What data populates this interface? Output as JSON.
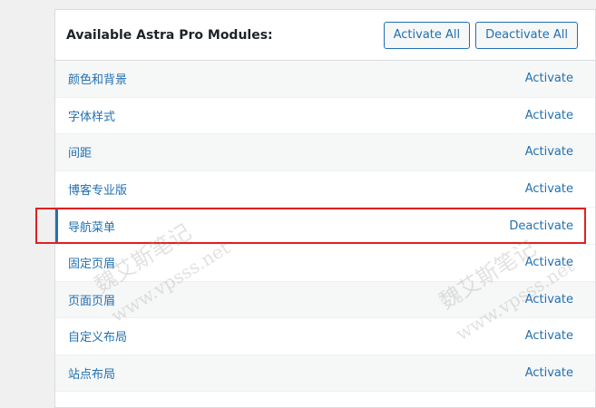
{
  "header": {
    "title": "Available Astra Pro Modules:",
    "activate_all_label": "Activate All",
    "deactivate_all_label": "Deactivate All"
  },
  "modules": [
    {
      "name": "颜色和背景",
      "action": "Activate",
      "active": false
    },
    {
      "name": "字体样式",
      "action": "Activate",
      "active": false
    },
    {
      "name": "间距",
      "action": "Activate",
      "active": false
    },
    {
      "name": "博客专业版",
      "action": "Activate",
      "active": false
    },
    {
      "name": "导航菜单",
      "action": "Deactivate",
      "active": true
    },
    {
      "name": "固定页眉",
      "action": "Activate",
      "active": false
    },
    {
      "name": "页面页眉",
      "action": "Activate",
      "active": false
    },
    {
      "name": "自定义布局",
      "action": "Activate",
      "active": false
    },
    {
      "name": "站点布局",
      "action": "Activate",
      "active": false
    }
  ],
  "watermark": {
    "line1": "魏艾斯笔记",
    "line2": "www.vpsss.net"
  },
  "colors": {
    "link": "#2271b1",
    "highlight": "#e0201f",
    "border": "#dcdcde"
  }
}
